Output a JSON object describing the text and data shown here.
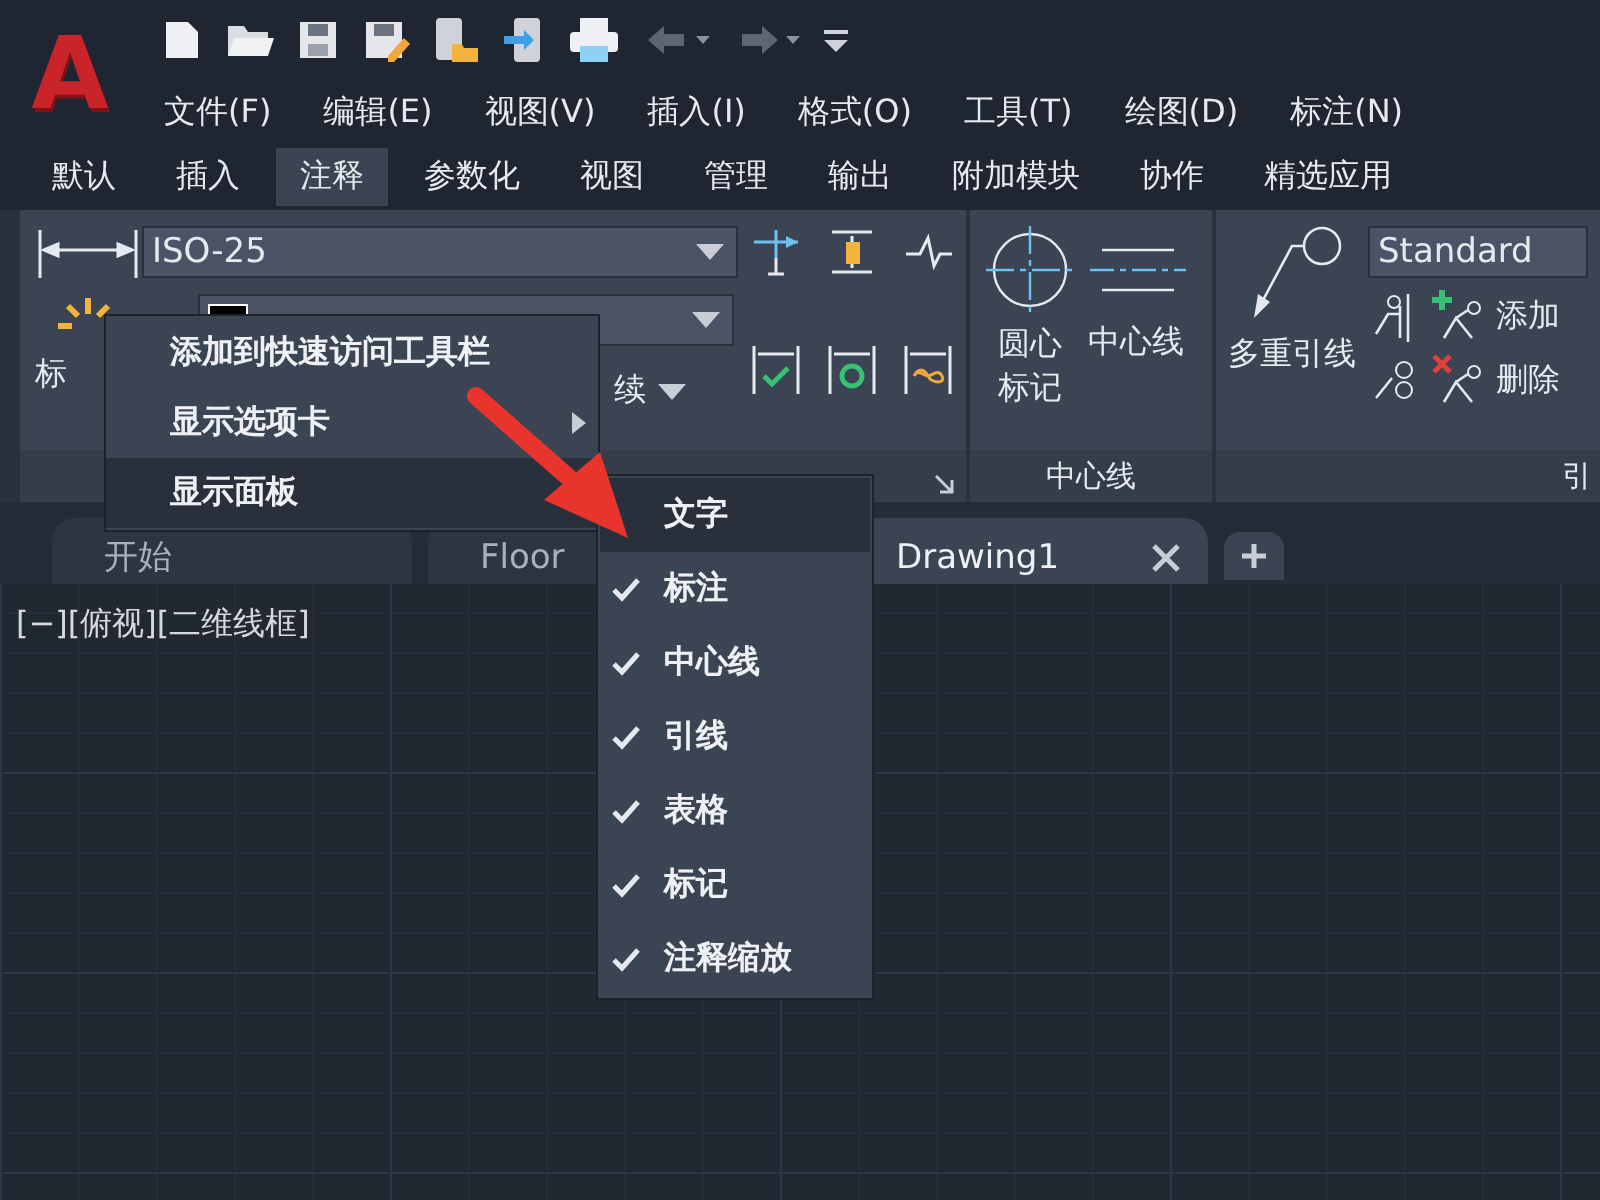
{
  "app": {
    "logo": "A"
  },
  "menu_bar": [
    "文件(F)",
    "编辑(E)",
    "视图(V)",
    "插入(I)",
    "格式(O)",
    "工具(T)",
    "绘图(D)",
    "标注(N)"
  ],
  "ribbon_tabs": [
    {
      "label": "默认",
      "selected": false
    },
    {
      "label": "插入",
      "selected": false
    },
    {
      "label": "注释",
      "selected": true
    },
    {
      "label": "参数化",
      "selected": false
    },
    {
      "label": "视图",
      "selected": false
    },
    {
      "label": "管理",
      "selected": false
    },
    {
      "label": "输出",
      "selected": false
    },
    {
      "label": "附加模块",
      "selected": false
    },
    {
      "label": "协作",
      "selected": false
    },
    {
      "label": "精选应用",
      "selected": false
    }
  ],
  "dimension_panel": {
    "button_label": "标",
    "style_dropdown": "ISO-25",
    "continue_label": "续"
  },
  "centerline_panel": {
    "buttons": [
      "圆心标记",
      "中心线"
    ],
    "title": "中心线"
  },
  "leader_panel": {
    "button_label": "多重引线",
    "style_dropdown": "Standard",
    "actions": [
      "添加",
      "删除"
    ],
    "title": "引"
  },
  "document_tabs": [
    {
      "label": "开始",
      "selected": false
    },
    {
      "label": "Floor",
      "selected": false
    },
    {
      "label": "Drawing1",
      "selected": true
    }
  ],
  "viewport": {
    "label": "[−][俯视][二维线框]"
  },
  "context_menu": {
    "items": [
      {
        "label": "添加到快速访问工具栏",
        "submenu": false,
        "selected": false
      },
      {
        "label": "显示选项卡",
        "submenu": true,
        "selected": false
      },
      {
        "label": "显示面板",
        "submenu": true,
        "selected": true
      }
    ]
  },
  "panels_submenu": {
    "items": [
      {
        "label": "文字",
        "checked": false,
        "selected": true
      },
      {
        "label": "标注",
        "checked": true,
        "selected": false
      },
      {
        "label": "中心线",
        "checked": true,
        "selected": false
      },
      {
        "label": "引线",
        "checked": true,
        "selected": false
      },
      {
        "label": "表格",
        "checked": true,
        "selected": false
      },
      {
        "label": "标记",
        "checked": true,
        "selected": false
      },
      {
        "label": "注释缩放",
        "checked": true,
        "selected": false
      }
    ]
  }
}
